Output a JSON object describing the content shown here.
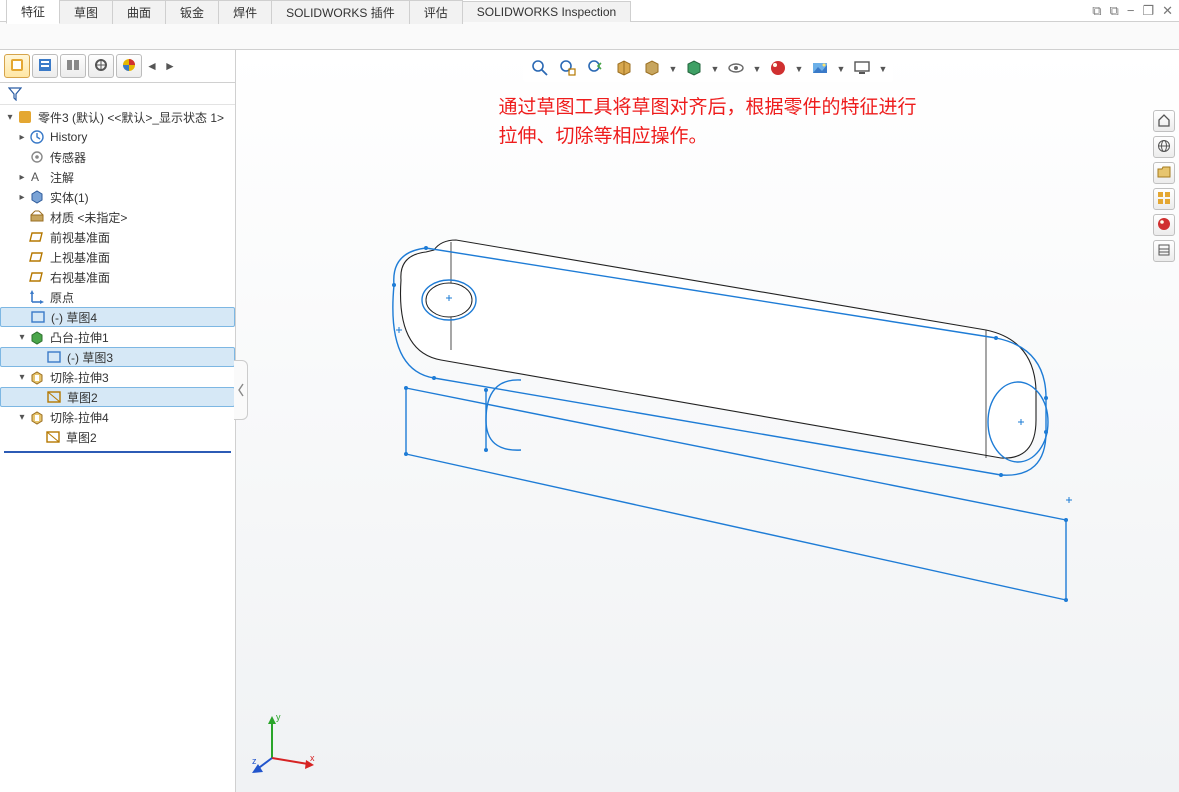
{
  "ribbon": {
    "tabs": [
      "特征",
      "草图",
      "曲面",
      "钣金",
      "焊件",
      "SOLIDWORKS 插件",
      "评估",
      "SOLIDWORKS Inspection"
    ],
    "active_index": 0
  },
  "window_controls": {
    "popout1": "⧉",
    "popout2": "⧉",
    "minimize": "−",
    "restore": "❐",
    "close": "✕"
  },
  "panel_tabs": {
    "items": [
      "feature-tree",
      "property-manager",
      "configuration-manager",
      "dimxpert",
      "display-manager"
    ],
    "active_index": 0
  },
  "filter": {
    "label": ""
  },
  "tree": {
    "root": "零件3 (默认) <<默认>_显示状态 1>",
    "items": [
      {
        "label": "History",
        "icon": "history-icon",
        "indent": 1,
        "exp": "▸"
      },
      {
        "label": "传感器",
        "icon": "sensor-icon",
        "indent": 1,
        "exp": ""
      },
      {
        "label": "注解",
        "icon": "annotation-icon",
        "indent": 1,
        "exp": "▸"
      },
      {
        "label": "实体(1)",
        "icon": "solidbody-icon",
        "indent": 1,
        "exp": "▸"
      },
      {
        "label": "材质 <未指定>",
        "icon": "material-icon",
        "indent": 1,
        "exp": ""
      },
      {
        "label": "前视基准面",
        "icon": "plane-icon",
        "indent": 1,
        "exp": ""
      },
      {
        "label": "上视基准面",
        "icon": "plane-icon",
        "indent": 1,
        "exp": ""
      },
      {
        "label": "右视基准面",
        "icon": "plane-icon",
        "indent": 1,
        "exp": ""
      },
      {
        "label": "原点",
        "icon": "origin-icon",
        "indent": 1,
        "exp": ""
      },
      {
        "label": "(-) 草图4",
        "icon": "sketch-icon",
        "indent": 1,
        "exp": "",
        "selected": true
      },
      {
        "label": "凸台-拉伸1",
        "icon": "extrude-boss-icon",
        "indent": 1,
        "exp": "▾"
      },
      {
        "label": "(-) 草图3",
        "icon": "sketch-icon",
        "indent": 2,
        "exp": "",
        "selected": true
      },
      {
        "label": "切除-拉伸3",
        "icon": "extrude-cut-icon",
        "indent": 1,
        "exp": "▾"
      },
      {
        "label": "草图2",
        "icon": "derived-sketch-icon",
        "indent": 2,
        "exp": "",
        "selected": true
      },
      {
        "label": "切除-拉伸4",
        "icon": "extrude-cut-icon",
        "indent": 1,
        "exp": "▾"
      },
      {
        "label": "草图2",
        "icon": "derived-sketch-icon",
        "indent": 2,
        "exp": ""
      }
    ]
  },
  "hud": {
    "items": [
      "zoom-fit-icon",
      "zoom-area-icon",
      "previous-view-icon",
      "section-view-icon",
      "view-orient-icon",
      "display-style-icon",
      "hide-show-icon",
      "edit-appearance-icon",
      "apply-scene-icon",
      "view-settings-icon"
    ]
  },
  "annotation": {
    "line1": "通过草图工具将草图对齐后，根据零件的特征进行",
    "line2": "拉伸、切除等相应操作。"
  },
  "taskpane": {
    "items": [
      "home-icon",
      "resources-icon",
      "library-icon",
      "view-palette-icon",
      "appearances-icon",
      "custom-props-icon"
    ]
  },
  "triad": {
    "x": "x",
    "y": "y",
    "z": "z"
  }
}
